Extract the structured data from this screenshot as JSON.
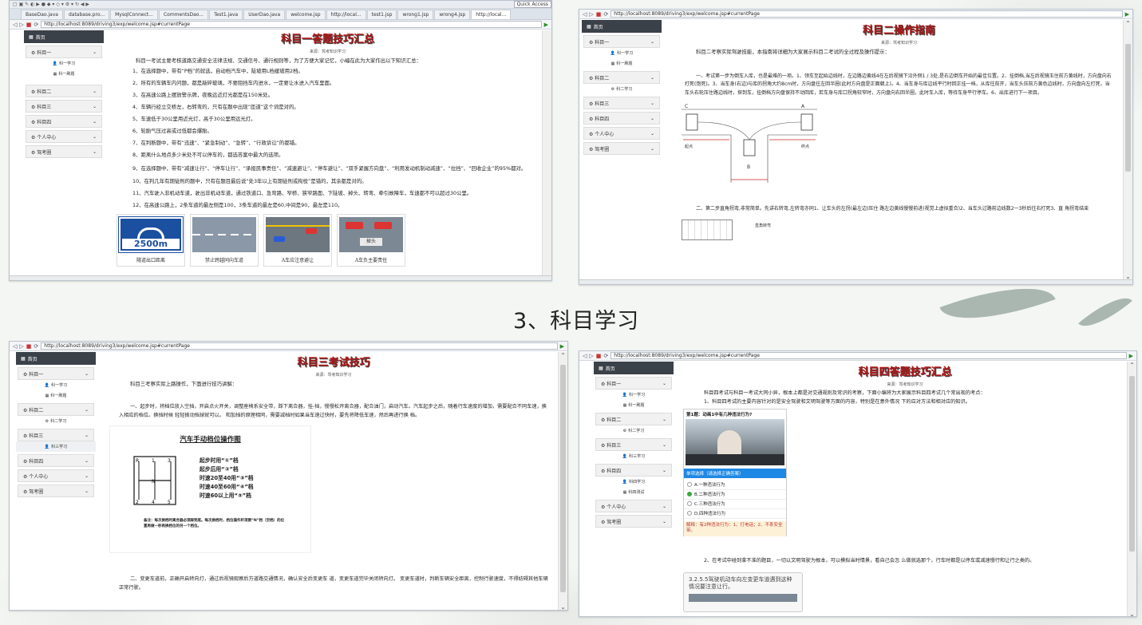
{
  "section_heading": "3、科目学习",
  "window1": {
    "toolbar_label": "Quick Access",
    "tabs": [
      "BaseDao.java",
      "database.pro...",
      "MysqlConnect...",
      "CommentsDao...",
      "Test1.java",
      "UserDao.java",
      "welcome.jsp",
      "http://local...",
      "test1.jsp",
      "wrong1.jsp",
      "wrong4.jsp",
      "http://local..."
    ],
    "url": "http://localhost:8089/driving3/exp/welcome.jsp#currentPage",
    "page_title": "科目一答题技巧汇总",
    "source": "来源：驾考知识学习",
    "intro": "科目一考试主要考核道路交通安全法律法规、交通信号、通行规则等，为了方便大家记忆，小编在此为大家作出以下知识汇总：",
    "items": [
      "1、在选择题中，带有“P档”的就选，自动档汽车中，陡坡用L档缓坡用2档。",
      "2、所有的车辆车内问题，都是敲碎玻璃，不要阻挡车内进水，一定要让水进入汽车里面。",
      "3、在高速公路上摆放警示牌，夜晚远近灯光都是在150米处。",
      "4、车辆行经立交桥左，右转弯的，只有在题中出现”匝道”这个词是对的。",
      "5、车速低于30公里用近光灯，高于30公里用远光灯。",
      "6、轮胎气压过高或过低都会爆胎。",
      "7、在判断题中，带有“迅速”、“紧急制动”、“急转”、“行政诉讼”的都错。",
      "8、距离什么地点多少米处不可以停车的，都选答案中最大的选项。",
      "9、在选择题中，带有“减速让行”、“停车让行”、“承担民事责任”、“减速避让”、“停车避让”、“双手紧握方向盘”、“利用发动机制动减速”、“拉挡”、“回收企业”的95%都对。",
      "10、在判几年有期徒刑的题中，只有在题目最后说“处3年以上有期徒刑或拘役”是错的，其余都是对的。",
      "11、汽车驶入非机动车道，驶出非机动车道，通过铁道口、急弯路、窄桥、狭窄路面、下陡坡、掉头、转弯、牵引故障车，车速都不可以超过30公里。",
      "12、在高速公路上，2条车道的最左侧是100，3条车道的最左是60,中间是90，最左是110。"
    ],
    "images": [
      {
        "caption": "隧道出口距离",
        "sign_text": "2500m"
      },
      {
        "caption": "禁止跨越同向车道"
      },
      {
        "caption": "A车应注意避让"
      },
      {
        "caption": "A车负主要责任",
        "sign_text": "掉头"
      }
    ],
    "sidebar": {
      "home": "首页",
      "menus": [
        "科目一",
        "科目二",
        "科目三",
        "科目四",
        "个人中心",
        "驾考圈"
      ],
      "subs": [
        "科一学习",
        "科一刷题"
      ]
    }
  },
  "window2": {
    "url": "http://localhost:8089/driving3/exp/welcome.jsp#currentPage",
    "page_title": "科目二操作指南",
    "source": "来源：驾考知识学习",
    "intro": "科目二考察实际驾驶技能，本指南将详细为大家展示科目二考试的全过程及操作提示：",
    "para1": "一、考试第一步为倒车入库，也是最难的一项。1、领车至起始边线时，左边路边黄线4在左后视镜下沿外侧1 / 3处,是右边倒车开始的最佳位置。2、挂倒档,当左后视镜玉住前方黄线时，方向盘向右打死(饱死)。3、当车身(右边)与库的拐角大约8cm时，方向盘往左回半圈(此时方向盘是正面朝上)。4、当车身与库边线平行时回正挂一档，从库往前开，当车头压前方黄色边线时，方向盘向左打死，当车头右轮压住路边线时，探到车，挂倒档方向盘保持不动回库，若车身与库口拐角较窄时，方向盘向右回半圈，此时车入库，等待车身平行停车。6、出库进行下一项目。",
    "para2": "二、第二步直角拐弯,非常简单。先讲右转弯,左转弯亦同1、让车头的左拐(最左边)压住 路左边黄线慢慢前进(视觉上虚拟重合)2、当车头过路前边线数2一3秒后往右打死3、直 角拐弯结束",
    "diagram_labels": [
      "A",
      "B",
      "C",
      "起点",
      "终点"
    ],
    "small_caption": "直角转弯",
    "sidebar": {
      "home": "首页",
      "menus": [
        "科目一",
        "科目二",
        "科目三",
        "科目四",
        "个人中心",
        "驾考圈"
      ],
      "subs1": [
        "科一学习",
        "科一刷题"
      ],
      "subs2": [
        "科二学习"
      ]
    }
  },
  "window3": {
    "url": "http://localhost:8089/driving3/exp/welcome.jsp#currentPage",
    "page_title": "科目三考试技巧",
    "source": "来源：驾考知识学习",
    "intro": "科目三考察实际上路操作，下面进行技巧讲解：",
    "para1": "一、起步时，将档位放入空挡，开启点火开关，调整座椅系安全带，踩下离合器，挂-挡，慢慢松开离合器，配合油门，启动汽车。汽车起步之后，随着行车速度的增加，需要配合不同车速，换入相应的档位。换挡时候 轻轻拨动挡球就可以。 和加挡的原理相同，需要减档时如果当车速过快时，要先将降低车速，然后再进行换 档。",
    "gear_title": "汽车手动档位操作图",
    "gear_rules": [
      "起步时用“①”档",
      "起步后用“②”档",
      "时速20至40用“③”档",
      "时速40至60用“④”档",
      "时速60以上用“⑤”档"
    ],
    "gear_note": "备注：每次换档时离合器必须踩到底。每次换档时，档位操作杆须要“N”档（空档）的位置再做一秒再换档位的另一个档位。",
    "para2": "二、变更车道前，正确开启转向灯，通过后视镜观察后方道路交通情况，确认安全后变更车 道，变更车道完毕关闭转向灯。 变更车道时，判断车辆安全距离，控制行驶速度，不得妨碍其他车辆正常行驶。",
    "sidebar": {
      "home": "首页",
      "menus": [
        "科目一",
        "科目二",
        "科目三",
        "科目四",
        "个人中心",
        "驾考圈"
      ],
      "subs1": [
        "科一学习",
        "科一刷题"
      ],
      "subs2": [
        "科二学习"
      ],
      "subs3": [
        "科三学习"
      ]
    }
  },
  "window4": {
    "url": "http://localhost:8089/driving3/exp/welcome.jsp#currentPage",
    "page_title": "科目四答题技巧汇总",
    "source": "来源：驾考知识学习",
    "intro": "科目四考试与科目一考试大同小异，根本上都是对交通规则及常识的考察，下面小编将为大家展示科目四考试几个常出现的考点：",
    "para1": "1、科目四考试的主要内容针对的是安全驾驶和文明驾驶等方面的内容，特别是在意外情况 下的应对方法和相对应的知识。",
    "quiz": {
      "question": "第1题：动画1中有几种违法行为?",
      "type_label": "单项选择（请选择正确答案）",
      "options": [
        "A.一种违法行为",
        "B.二种违法行为",
        "C.三种违法行为",
        "D.四种违法行为"
      ],
      "selected_index": 1,
      "explain": "解释：有2种违法行为：1、打电话；2、不系安全带。"
    },
    "para2": "2、在考试中碰到拿不准的题目，一切以文明驾驶为根本，可以模拟当时情景，看自己会怎 么做就选那个，行车时都是以停车或减速慢行和让行之类的。",
    "card_text": "3.2.5.5驾驶机动车向左变更车道遇到这种情况要注意让行。",
    "sidebar": {
      "home": "首页",
      "menus": [
        "科目一",
        "科目二",
        "科目三",
        "科目四",
        "个人中心",
        "驾考圈"
      ],
      "subs1": [
        "科一学习",
        "科一刷题"
      ],
      "subs2": [
        "科二学习"
      ],
      "subs3": [
        "科三学习"
      ],
      "subs4": [
        "科四学习",
        "科四测试"
      ]
    }
  }
}
